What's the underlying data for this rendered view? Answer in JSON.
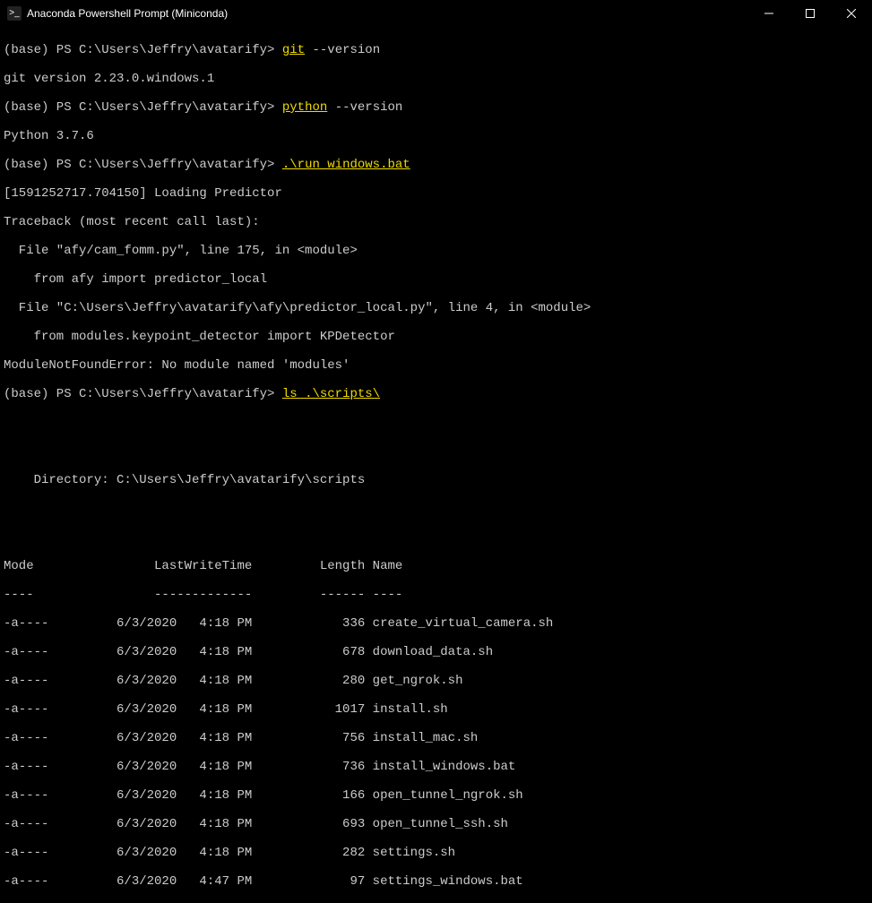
{
  "window": {
    "title": "Anaconda Powershell Prompt (Miniconda)"
  },
  "session": {
    "prompt": "(base) PS C:\\Users\\Jeffry\\avatarify>",
    "commands": [
      {
        "cmd": "git",
        "arg": "--version"
      },
      {
        "cmd": "python",
        "arg": "--version"
      },
      {
        "cmd": ".\\run_windows.bat",
        "arg": ""
      },
      {
        "cmd": "ls .\\scripts\\",
        "arg": ""
      }
    ],
    "git_version": "git version 2.23.0.windows.1",
    "python_version": "Python 3.7.6",
    "traceback": {
      "l1": "[1591252717.704150] Loading Predictor",
      "l2": "Traceback (most recent call last):",
      "l3": "  File \"afy/cam_fomm.py\", line 175, in <module>",
      "l4": "    from afy import predictor_local",
      "l5": "  File \"C:\\Users\\Jeffry\\avatarify\\afy\\predictor_local.py\", line 4, in <module>",
      "l6": "    from modules.keypoint_detector import KPDetector",
      "l7": "ModuleNotFoundError: No module named 'modules'"
    },
    "listing": {
      "dir_label": "    Directory: C:\\Users\\Jeffry\\avatarify\\scripts",
      "header": "Mode                LastWriteTime         Length Name",
      "divider": "----                -------------         ------ ----",
      "rows": [
        "-a----         6/3/2020   4:18 PM            336 create_virtual_camera.sh",
        "-a----         6/3/2020   4:18 PM            678 download_data.sh",
        "-a----         6/3/2020   4:18 PM            280 get_ngrok.sh",
        "-a----         6/3/2020   4:18 PM           1017 install.sh",
        "-a----         6/3/2020   4:18 PM            756 install_mac.sh",
        "-a----         6/3/2020   4:18 PM            736 install_windows.bat",
        "-a----         6/3/2020   4:18 PM            166 open_tunnel_ngrok.sh",
        "-a----         6/3/2020   4:18 PM            693 open_tunnel_ssh.sh",
        "-a----         6/3/2020   4:18 PM            282 settings.sh",
        "-a----         6/3/2020   4:47 PM             97 settings_windows.bat"
      ]
    }
  }
}
